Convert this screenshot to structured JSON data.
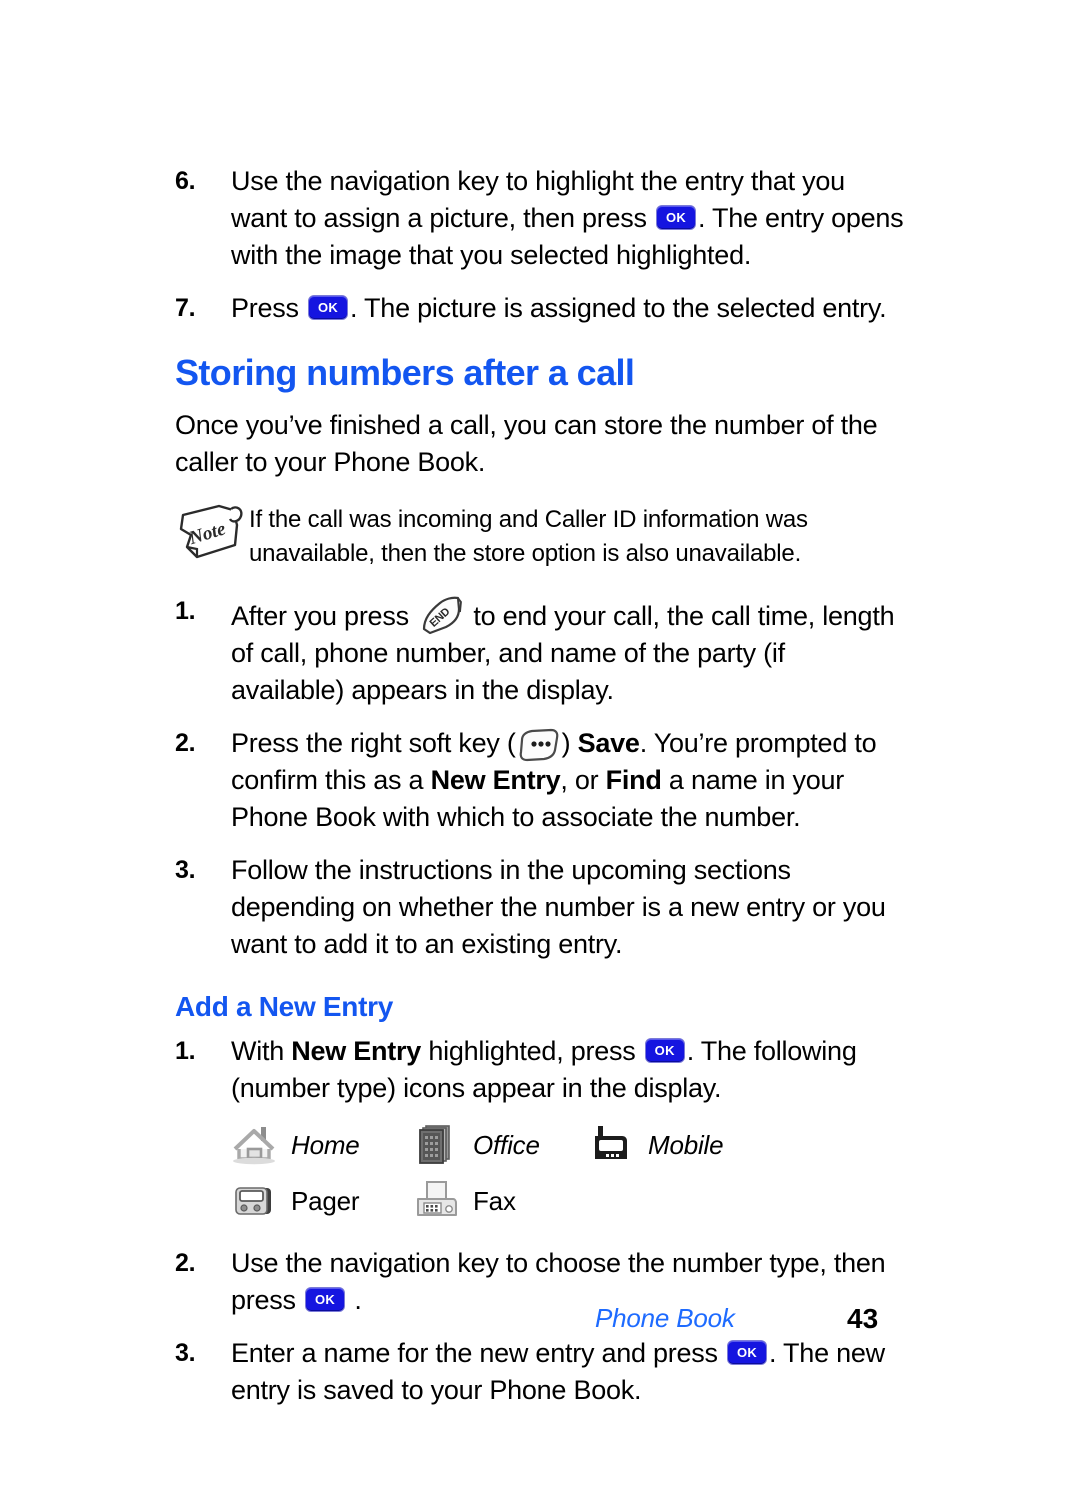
{
  "document": {
    "type": "user-manual-page",
    "page_number": "43",
    "chapter_footer": "Phone Book",
    "accent_color": "#1356f0",
    "ok_key_color": "#1515e0"
  },
  "steps_top": [
    {
      "number": "6.",
      "text_before": "Use the navigation key to highlight the entry that you want to assign a picture, then press",
      "key": "OK",
      "text_after": ". The entry opens with the image that you selected highlighted."
    },
    {
      "number": "7.",
      "text_before": "Press",
      "key": "OK",
      "text_after": ". The picture is assigned to the selected entry."
    }
  ],
  "section": {
    "heading": "Storing numbers after a call",
    "intro": "Once you’ve finished a call, you can store the number of the caller to your Phone Book.",
    "note": {
      "icon_label": "Note",
      "text": "If the call was incoming and Caller ID information was unavailable, then the store option is also unavailable."
    },
    "steps": [
      {
        "number": "1.",
        "part1": "After you press",
        "key": "END",
        "part2": "to end your call, the call time, length of call, phone number, and name of the party (if available) appears in the display."
      },
      {
        "number": "2.",
        "part1": "Press the right soft key (",
        "key": "soft-key",
        "part2": ")",
        "bold1": "Save",
        "part3": ". You’re prompted to confirm this as a",
        "bold2": "New Entry",
        "part4": ", or",
        "bold3": "Find",
        "part5": "a name in your Phone Book with which to associate the number."
      },
      {
        "number": "3.",
        "text": "Follow the instructions in the upcoming sections depending on whether the number is a new entry or you want to add it to an existing entry."
      }
    ]
  },
  "subsection": {
    "heading": "Add a New Entry",
    "step1": {
      "number": "1.",
      "part1": "With",
      "bold1": "New Entry",
      "part2": "highlighted, press",
      "key": "OK",
      "part3": ". The following (number type) icons appear in the display."
    },
    "number_types": [
      {
        "icon": "home-icon",
        "label": "Home",
        "italic": true
      },
      {
        "icon": "office-icon",
        "label": "Office",
        "italic": true
      },
      {
        "icon": "mobile-icon",
        "label": "Mobile",
        "italic": true
      },
      {
        "icon": "pager-icon",
        "label": "Pager",
        "italic": false
      },
      {
        "icon": "fax-icon",
        "label": "Fax",
        "italic": false
      }
    ],
    "step2": {
      "number": "2.",
      "part1": "Use the navigation key to choose the number type, then press",
      "key": "OK",
      "part2": "."
    },
    "step3": {
      "number": "3.",
      "part1": "Enter a name for the new entry and press",
      "key": "OK",
      "part2": ". The new entry is saved to your Phone Book."
    }
  }
}
